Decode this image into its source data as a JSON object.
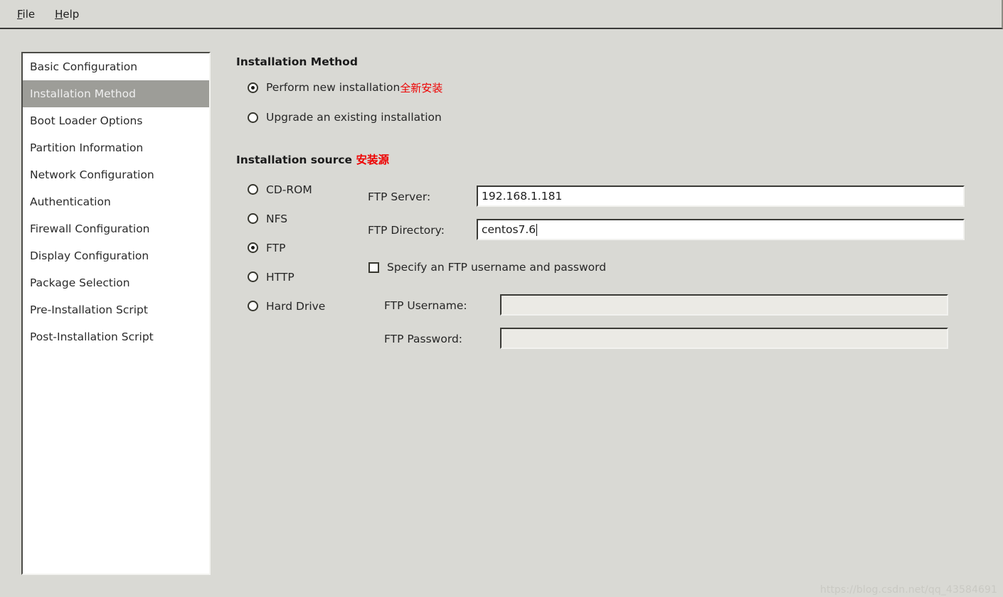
{
  "window": {
    "background_color": "#d9d9d4",
    "accent_annotation_color": "#ee0000",
    "selection_color": "#9d9d98"
  },
  "menubar": {
    "items": [
      {
        "label": "File",
        "accelerator": "F"
      },
      {
        "label": "Help",
        "accelerator": "H"
      }
    ]
  },
  "sidebar": {
    "selected_index": 1,
    "items": [
      {
        "label": "Basic Configuration"
      },
      {
        "label": "Installation Method"
      },
      {
        "label": "Boot Loader Options"
      },
      {
        "label": "Partition Information"
      },
      {
        "label": "Network Configuration"
      },
      {
        "label": "Authentication"
      },
      {
        "label": "Firewall Configuration"
      },
      {
        "label": "Display Configuration"
      },
      {
        "label": "Package Selection"
      },
      {
        "label": "Pre-Installation Script"
      },
      {
        "label": "Post-Installation Script"
      }
    ]
  },
  "main": {
    "install_method": {
      "title": "Installation Method",
      "options": [
        {
          "label": "Perform new installation",
          "annotation": "全新安装",
          "selected": true
        },
        {
          "label": "Upgrade an existing installation",
          "annotation": "",
          "selected": false
        }
      ]
    },
    "install_source": {
      "title": "Installation source",
      "title_annotation": "安装源",
      "options": [
        {
          "label": "CD-ROM",
          "selected": false
        },
        {
          "label": "NFS",
          "selected": false
        },
        {
          "label": "FTP",
          "selected": true
        },
        {
          "label": "HTTP",
          "selected": false
        },
        {
          "label": "Hard Drive",
          "selected": false
        }
      ],
      "ftp_server": {
        "label": "FTP Server:",
        "value": "192.168.1.181",
        "placeholder": "",
        "focused": false,
        "enabled": true
      },
      "ftp_directory": {
        "label": "FTP Directory:",
        "value": "centos7.6",
        "placeholder": "",
        "focused": true,
        "enabled": true
      },
      "specify_credentials": {
        "label": "Specify an FTP username and password",
        "checked": false
      },
      "ftp_username": {
        "label": "FTP Username:",
        "value": "",
        "placeholder": "",
        "enabled": false
      },
      "ftp_password": {
        "label": "FTP Password:",
        "value": "",
        "placeholder": "",
        "enabled": false
      }
    }
  },
  "watermark": {
    "text": "https://blog.csdn.net/qq_43584691"
  }
}
